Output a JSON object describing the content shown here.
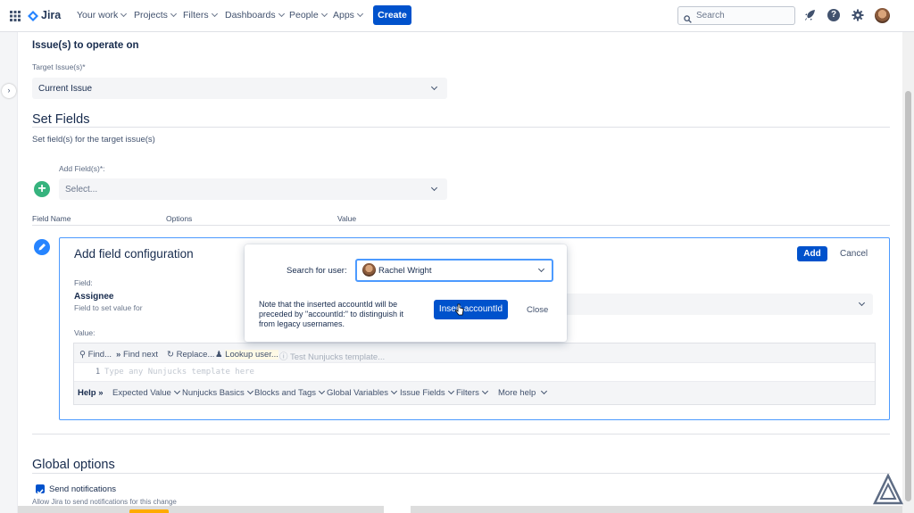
{
  "nav": {
    "app_name": "Jira",
    "items": [
      {
        "label": "Your work"
      },
      {
        "label": "Projects"
      },
      {
        "label": "Filters"
      },
      {
        "label": "Dashboards"
      },
      {
        "label": "People"
      },
      {
        "label": "Apps"
      }
    ],
    "create_label": "Create",
    "search_placeholder": "Search",
    "icons": [
      "app-switcher-icon",
      "jira-logo-icon",
      "search-icon",
      "notifications-icon",
      "help-icon",
      "settings-icon",
      "avatar"
    ]
  },
  "issues_section": {
    "title": "Issue(s) to operate on",
    "target_label": "Target Issue(s)*",
    "target_value": "Current Issue"
  },
  "set_fields": {
    "title": "Set Fields",
    "description": "Set field(s) for the target issue(s)",
    "add_fields_label": "Add Field(s)*:",
    "add_fields_placeholder": "Select...",
    "columns": [
      "Field Name",
      "Options",
      "Value"
    ]
  },
  "config": {
    "title": "Add field configuration",
    "add_label": "Add",
    "cancel_label": "Cancel",
    "field_label": "Field:",
    "field_value": "Assignee",
    "field_help": "Field to set value for",
    "value_label": "Value:",
    "editor_toolbar": {
      "find": "Find...",
      "find_next": "Find next",
      "replace": "Replace...",
      "lookup_user": "Lookup user...",
      "test_template": "Test Nunjucks template..."
    },
    "line_number": "1",
    "editor_placeholder": "Type any Nunjucks template here",
    "help_bar": {
      "help": "Help",
      "expected_value": "Expected Value",
      "nunjucks_basics": "Nunjucks Basics",
      "blocks_tags": "Blocks and Tags",
      "global_variables": "Global Variables",
      "issue_fields": "Issue Fields",
      "filters": "Filters",
      "more_help": "More help"
    }
  },
  "modal": {
    "search_label": "Search for user:",
    "selected_user": "Rachel Wright",
    "note": "Note that the inserted accountId will be preceded by \"accountId:\" to distinguish it from legacy usernames.",
    "insert_label": "Insert accountId",
    "close_label": "Close"
  },
  "global_options": {
    "title": "Global options",
    "send_notifications_label": "Send notifications",
    "send_notifications_checked": true,
    "send_notifications_help": "Allow Jira to send notifications for this change"
  },
  "colors": {
    "primary": "#0052CC",
    "focus": "#4C9AFF",
    "add_circle": "#36B37E",
    "edit_circle": "#2684FF"
  }
}
